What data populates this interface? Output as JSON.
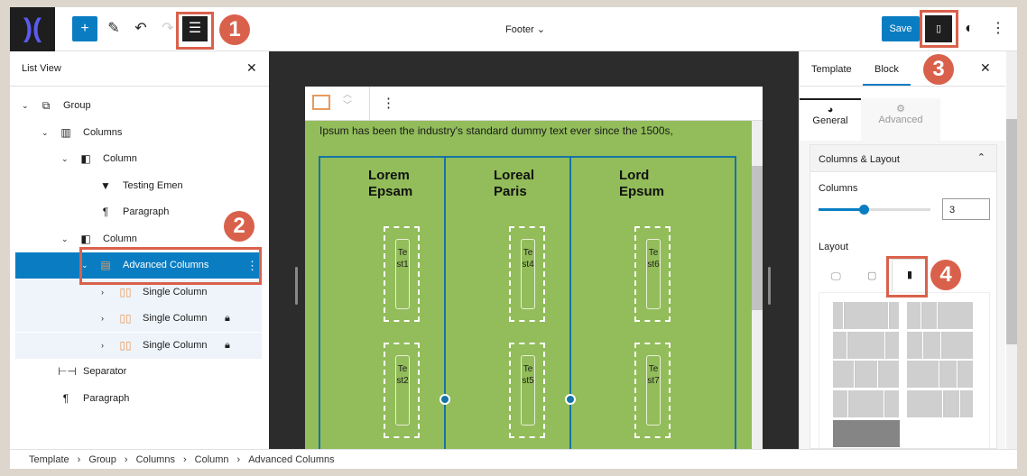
{
  "topbar": {
    "title": "Footer",
    "save": "Save"
  },
  "list_view": {
    "title": "List View",
    "items": [
      {
        "label": "Group",
        "icon": "group-icon"
      },
      {
        "label": "Columns",
        "icon": "columns-icon"
      },
      {
        "label": "Column",
        "icon": "column-icon"
      },
      {
        "label": "Testing Emen",
        "icon": "bookmark-icon"
      },
      {
        "label": "Paragraph",
        "icon": "paragraph-icon"
      },
      {
        "label": "Column",
        "icon": "column-icon"
      },
      {
        "label": "Advanced Columns",
        "icon": "advanced-columns-icon"
      },
      {
        "label": "Single Column",
        "icon": "single-column-icon"
      },
      {
        "label": "Single Column",
        "icon": "single-column-icon",
        "locked": true
      },
      {
        "label": "Single Column",
        "icon": "single-column-icon",
        "locked": true
      },
      {
        "label": "Separator",
        "icon": "separator-icon"
      },
      {
        "label": "Paragraph",
        "icon": "paragraph-icon"
      }
    ]
  },
  "canvas": {
    "text": "Ipsum has been the industry's standard dummy text ever since the 1500s,",
    "columns": [
      {
        "heading": "Lorem Epsam",
        "tests": [
          "Test1",
          "Test2"
        ]
      },
      {
        "heading": "Loreal Paris",
        "tests": [
          "Test4",
          "Test5"
        ]
      },
      {
        "heading": "Lord Epsum",
        "tests": [
          "Test6",
          "Test7"
        ]
      }
    ],
    "bg_color": "#92bd5a",
    "border_color": "#1673a5"
  },
  "sidebar": {
    "tabs": [
      "Template",
      "Block"
    ],
    "active_tab": "Block",
    "subtabs": [
      "General",
      "Advanced"
    ],
    "panel_title": "Columns & Layout",
    "columns_label": "Columns",
    "columns_value": "3",
    "columns_fraction": 0.4,
    "layout_label": "Layout"
  },
  "annotations": [
    "1",
    "2",
    "3",
    "4"
  ],
  "annotation_color": "#d9614c",
  "breadcrumb": [
    "Template",
    "Group",
    "Columns",
    "Column",
    "Advanced Columns"
  ],
  "accent": "#0a7dc2"
}
